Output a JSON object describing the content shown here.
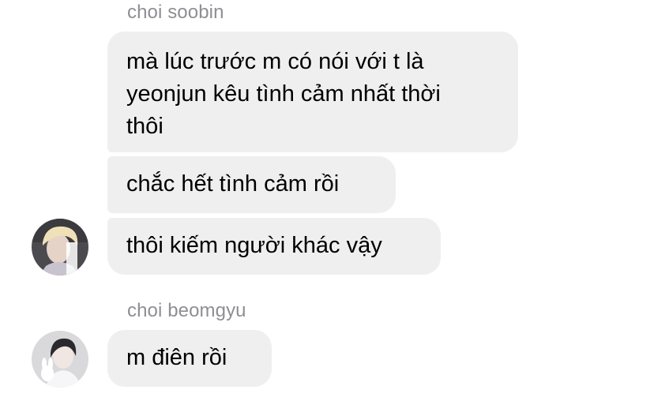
{
  "chat": {
    "groups": [
      {
        "sender": "choi soobin",
        "messages": [
          "mà lúc trước m có nói với t là",
          "yeonjun kêu tình cảm nhất thời",
          "thôi",
          "chắc hết tình cảm rồi",
          "thôi kiếm người khác vậy"
        ]
      },
      {
        "sender": "choi beomgyu",
        "messages": [
          "m điên rồi"
        ]
      }
    ]
  },
  "colors": {
    "bubble_bg": "#efefef",
    "sender_name": "#8e8e93",
    "text": "#000000"
  },
  "icons": [
    "avatar-soobin",
    "avatar-beomgyu"
  ]
}
